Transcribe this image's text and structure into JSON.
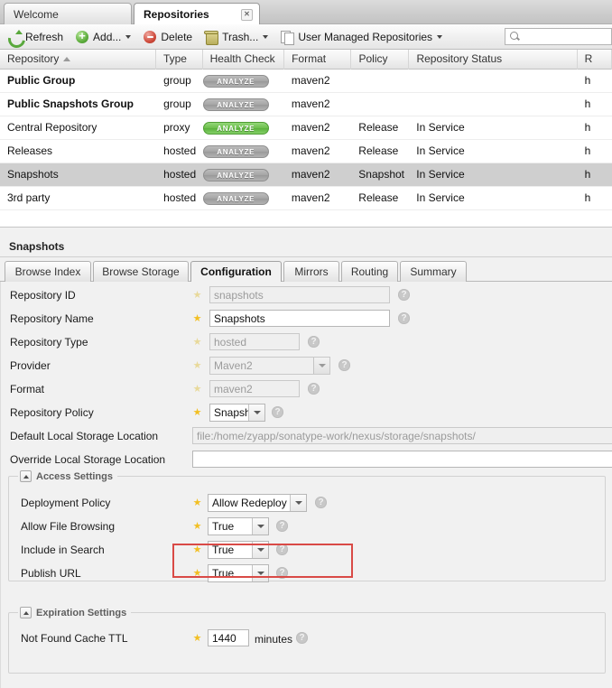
{
  "tabs": [
    {
      "label": "Welcome",
      "active": false,
      "closable": false
    },
    {
      "label": "Repositories",
      "active": true,
      "closable": true,
      "close_icon": "close-icon"
    }
  ],
  "toolbar": {
    "refresh_label": "Refresh",
    "add_label": "Add...",
    "delete_label": "Delete",
    "trash_label": "Trash...",
    "user_managed_label": "User Managed Repositories",
    "search_value": "",
    "search_placeholder": "",
    "icons": {
      "refresh": "refresh-icon",
      "add": "add-circle-icon",
      "delete": "delete-circle-icon",
      "trash": "trash-icon",
      "pages": "pages-icon",
      "search": "search-icon"
    }
  },
  "grid": {
    "columns": [
      {
        "label": "Repository",
        "sorted": "asc"
      },
      {
        "label": "Type"
      },
      {
        "label": "Health Check"
      },
      {
        "label": "Format"
      },
      {
        "label": "Policy"
      },
      {
        "label": "Repository Status"
      },
      {
        "label": "R"
      }
    ],
    "rows": [
      {
        "repository": "Public Group",
        "type": "group",
        "health": "ANALYZE",
        "health_state": "grey",
        "format": "maven2",
        "policy": "",
        "status": "",
        "extra": "h",
        "bold": true,
        "selected": false
      },
      {
        "repository": "Public Snapshots Group",
        "type": "group",
        "health": "ANALYZE",
        "health_state": "grey",
        "format": "maven2",
        "policy": "",
        "status": "",
        "extra": "h",
        "bold": true,
        "selected": false
      },
      {
        "repository": "Central Repository",
        "type": "proxy",
        "health": "ANALYZE",
        "health_state": "green",
        "format": "maven2",
        "policy": "Release",
        "status": "In Service",
        "extra": "h",
        "bold": false,
        "selected": false
      },
      {
        "repository": "Releases",
        "type": "hosted",
        "health": "ANALYZE",
        "health_state": "grey",
        "format": "maven2",
        "policy": "Release",
        "status": "In Service",
        "extra": "h",
        "bold": false,
        "selected": false
      },
      {
        "repository": "Snapshots",
        "type": "hosted",
        "health": "ANALYZE",
        "health_state": "grey",
        "format": "maven2",
        "policy": "Snapshot",
        "status": "In Service",
        "extra": "h",
        "bold": false,
        "selected": true
      },
      {
        "repository": "3rd party",
        "type": "hosted",
        "health": "ANALYZE",
        "health_state": "grey",
        "format": "maven2",
        "policy": "Release",
        "status": "In Service",
        "extra": "h",
        "bold": false,
        "selected": false
      }
    ]
  },
  "detail": {
    "title": "Snapshots",
    "subtabs": [
      {
        "label": "Browse Index",
        "active": false
      },
      {
        "label": "Browse Storage",
        "active": false
      },
      {
        "label": "Configuration",
        "active": true
      },
      {
        "label": "Mirrors",
        "active": false
      },
      {
        "label": "Routing",
        "active": false
      },
      {
        "label": "Summary",
        "active": false
      }
    ],
    "fields": [
      {
        "label": "Repository ID",
        "value": "snapshots",
        "kind": "text",
        "readonly": true,
        "required": true,
        "help": true
      },
      {
        "label": "Repository Name",
        "value": "Snapshots",
        "kind": "text",
        "readonly": false,
        "required": true,
        "help": true
      },
      {
        "label": "Repository Type",
        "value": "hosted",
        "kind": "text",
        "readonly": true,
        "required": true,
        "help": true
      },
      {
        "label": "Provider",
        "value": "Maven2",
        "kind": "select",
        "readonly": true,
        "required": true,
        "help": true
      },
      {
        "label": "Format",
        "value": "maven2",
        "kind": "text",
        "readonly": true,
        "required": true,
        "help": true
      },
      {
        "label": "Repository Policy",
        "value": "Snapshot",
        "kind": "select",
        "readonly": false,
        "required": true,
        "help": true
      },
      {
        "label": "Default Local Storage Location",
        "value": "file:/home/zyapp/sonatype-work/nexus/storage/snapshots/",
        "kind": "text",
        "readonly": true,
        "required": false,
        "help": false
      },
      {
        "label": "Override Local Storage Location",
        "value": "",
        "kind": "text",
        "readonly": false,
        "required": false,
        "help": false
      }
    ],
    "access_settings": {
      "legend": "Access Settings",
      "collapse_icon": "collapse-up-icon",
      "fields": [
        {
          "label": "Deployment Policy",
          "value": "Allow Redeploy",
          "kind": "select",
          "required": true,
          "help": true,
          "highlighted": true
        },
        {
          "label": "Allow File Browsing",
          "value": "True",
          "kind": "select",
          "required": true,
          "help": true,
          "highlighted": false
        },
        {
          "label": "Include in Search",
          "value": "True",
          "kind": "select",
          "required": true,
          "help": true,
          "highlighted": false
        },
        {
          "label": "Publish URL",
          "value": "True",
          "kind": "select",
          "required": true,
          "help": true,
          "highlighted": false
        }
      ]
    },
    "expiration_settings": {
      "legend": "Expiration Settings",
      "collapse_icon": "collapse-up-icon",
      "fields": [
        {
          "label": "Not Found Cache TTL",
          "value": "1440",
          "unit": "minutes",
          "kind": "text",
          "required": true,
          "help": true
        }
      ]
    }
  },
  "colors": {
    "highlight_box": "#d94a46",
    "health_green": "#6dbf4d",
    "health_grey": "#a6a6a6",
    "required_star": "#f2bf22",
    "selected_row": "#cfcfcf"
  }
}
